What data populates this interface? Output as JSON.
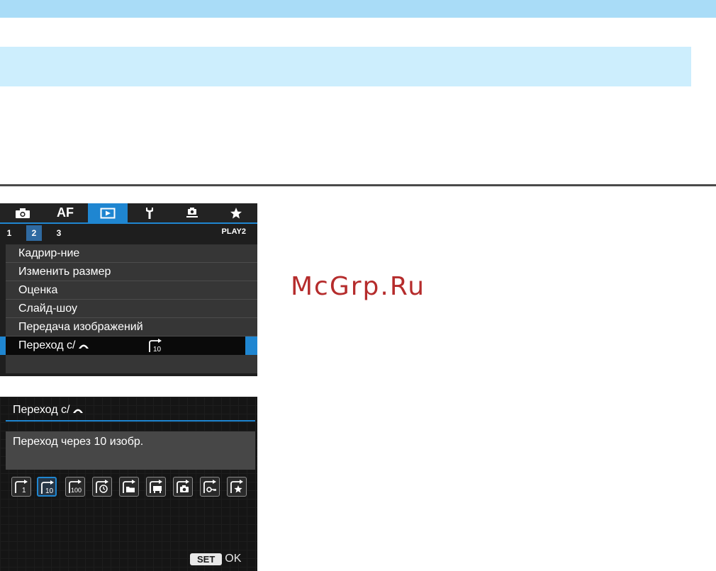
{
  "watermark": "McGrp.Ru",
  "menu": {
    "tabs": [
      {
        "icon": "camera-icon"
      },
      {
        "label": "AF"
      },
      {
        "icon": "playback-icon",
        "active": true
      },
      {
        "icon": "wrench-icon"
      },
      {
        "icon": "custom-functions-icon"
      },
      {
        "icon": "star-icon"
      }
    ],
    "subtabs": [
      "1",
      "2",
      "3"
    ],
    "active_subtab": "2",
    "page_label": "PLAY2",
    "items": [
      "Кадрир-ние",
      "Изменить размер",
      "Оценка",
      "Слайд-шоу",
      "Передача изображений",
      "Переход с/"
    ],
    "selected_value_icon": "jump-10-icon",
    "accent_color": "#1f86d1"
  },
  "detail": {
    "title": "Переход с/",
    "description": "Переход через 10 изобр.",
    "options": [
      {
        "icon": "jump-1-icon",
        "text": "1"
      },
      {
        "icon": "jump-10-icon",
        "text": "10",
        "selected": true
      },
      {
        "icon": "jump-100-icon",
        "text": "100"
      },
      {
        "icon": "jump-date-icon"
      },
      {
        "icon": "jump-folder-icon"
      },
      {
        "icon": "jump-movies-icon"
      },
      {
        "icon": "jump-stills-icon"
      },
      {
        "icon": "jump-protected-icon"
      },
      {
        "icon": "jump-rating-icon"
      }
    ],
    "set_label": "SET",
    "ok_label": "OK"
  }
}
